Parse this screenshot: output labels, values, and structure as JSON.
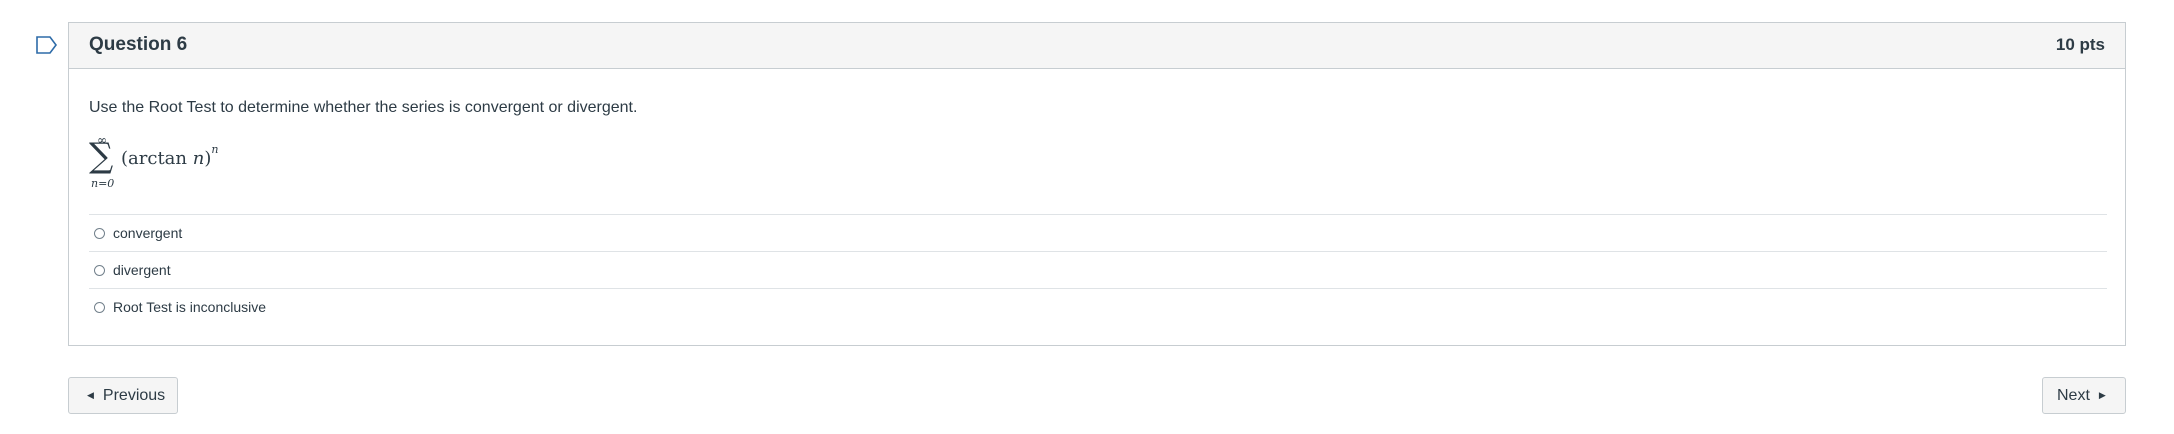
{
  "question": {
    "title": "Question 6",
    "points": "10 pts",
    "prompt": "Use the Root Test to determine whether the series is convergent or divergent.",
    "formula": {
      "upper_limit": "∞",
      "sigma": "∑",
      "lower_limit": "n=0",
      "expression_prefix": "(arctan ",
      "expression_var": "n",
      "expression_suffix": ")",
      "exponent": "n"
    },
    "answers": [
      {
        "label": "convergent",
        "selected": false
      },
      {
        "label": "divergent",
        "selected": false
      },
      {
        "label": "Root Test is inconclusive",
        "selected": false
      }
    ]
  },
  "navigation": {
    "previous_label": "Previous",
    "next_label": "Next",
    "previous_icon": "caret-left-icon",
    "next_icon": "caret-right-icon"
  },
  "flag_icon": "bookmark-flag-icon",
  "colors": {
    "text": "#2d3b45",
    "border": "#c7cdd1",
    "header_bg": "#f5f5f5"
  }
}
